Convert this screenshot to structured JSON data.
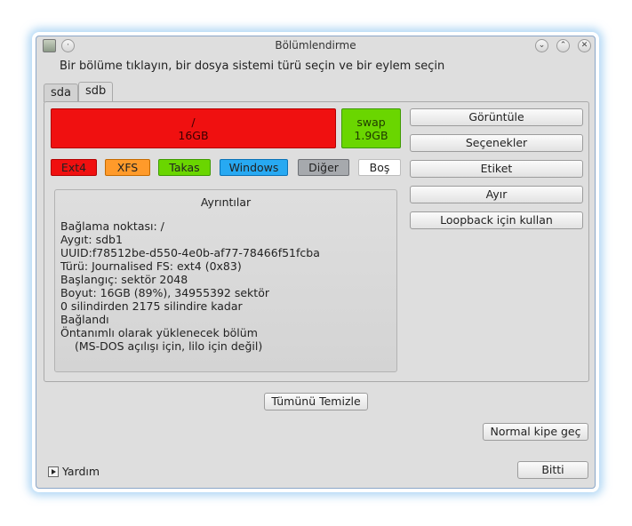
{
  "window": {
    "title": "Bölümlendirme",
    "titlebar_icons": [
      "app-icon",
      "pin-icon",
      "minimize-icon",
      "maximize-icon",
      "close-icon"
    ]
  },
  "instruction": "Bir bölüme tıklayın, bir dosya sistemi türü seçin ve bir eylem seçin",
  "tabs": [
    {
      "label": "sda",
      "active": false
    },
    {
      "label": "sdb",
      "active": true
    }
  ],
  "partitions": [
    {
      "name": "/",
      "size": "16GB",
      "color": "#f01010"
    },
    {
      "name": "swap",
      "size": "1.9GB",
      "color": "#6ad600"
    }
  ],
  "legend": [
    {
      "label": "Ext4",
      "color": "#f01010"
    },
    {
      "label": "XFS",
      "color": "#ff9a2a"
    },
    {
      "label": "Takas",
      "color": "#6ad600"
    },
    {
      "label": "Windows",
      "color": "#27a9f2"
    },
    {
      "label": "Diğer",
      "color": "#a6a9ad"
    },
    {
      "label": "Boş",
      "color": "#ffffff"
    }
  ],
  "details": {
    "title": "Ayrıntılar",
    "lines": [
      "Bağlama noktası: /",
      "Aygıt: sdb1",
      "UUID:f78512be-d550-4e0b-af77-78466f51fcba",
      "Türü: Journalised FS: ext4 (0x83)",
      "Başlangıç: sektör 2048",
      "Boyut: 16GB (89%), 34955392 sektör",
      "0 silindirden 2175 silindire kadar",
      "Bağlandı",
      "Öntanımlı olarak yüklenecek bölüm",
      "(MS-DOS açılışı için, lilo için değil)"
    ]
  },
  "actions": [
    "Görüntüle",
    "Seçenekler",
    "Etiket",
    "Ayır",
    "Loopback için kullan"
  ],
  "clear_all_label": "Tümünü Temizle",
  "normal_mode_label": "Normal kipe geç",
  "help_label": "Yardım",
  "done_label": "Bitti"
}
